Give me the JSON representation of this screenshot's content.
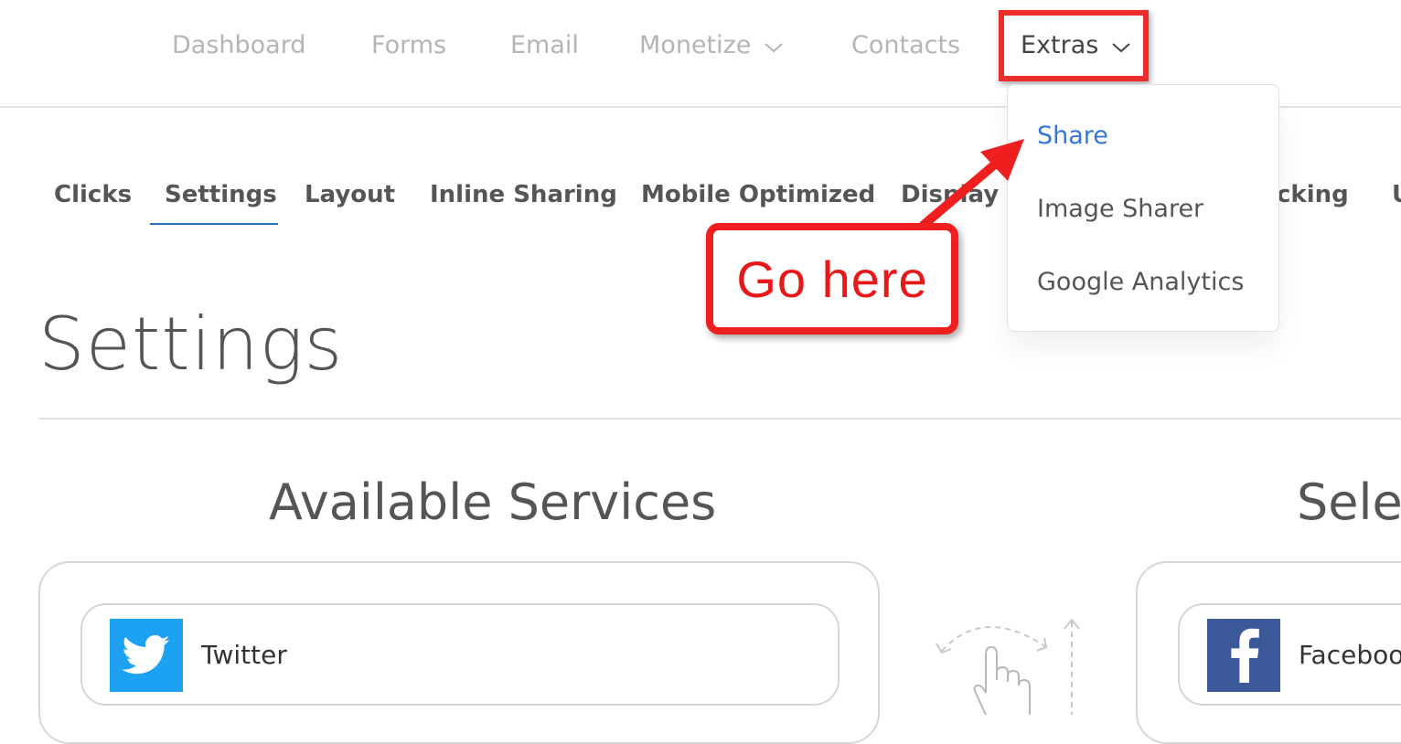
{
  "nav": {
    "items": [
      {
        "label": "Dashboard"
      },
      {
        "label": "Forms"
      },
      {
        "label": "Email"
      },
      {
        "label": "Monetize"
      },
      {
        "label": "Contacts"
      },
      {
        "label": "Extras"
      }
    ]
  },
  "dropdown": {
    "items": [
      {
        "label": "Share",
        "active": true
      },
      {
        "label": "Image Sharer"
      },
      {
        "label": "Google Analytics"
      }
    ]
  },
  "tabs": {
    "items": [
      {
        "label": "Clicks"
      },
      {
        "label": "Settings",
        "active": true
      },
      {
        "label": "Layout"
      },
      {
        "label": "Inline Sharing"
      },
      {
        "label": "Mobile Optimized"
      },
      {
        "label": "Display R"
      },
      {
        "label": "cking"
      },
      {
        "label": "U"
      }
    ]
  },
  "callout": {
    "text": "Go here"
  },
  "page": {
    "title": "Settings",
    "available_title": "Available Services",
    "selected_title": "Selec"
  },
  "services": {
    "available": [
      {
        "label": "Twitter",
        "icon": "twitter-icon",
        "color": "#1da1f2"
      }
    ],
    "selected": [
      {
        "label": "Faceboo",
        "icon": "facebook-icon",
        "color": "#3b5998"
      }
    ]
  },
  "colors": {
    "highlight": "#ef2b2b",
    "link_active": "#3178d4",
    "tab_underline": "#2d6fbf"
  }
}
